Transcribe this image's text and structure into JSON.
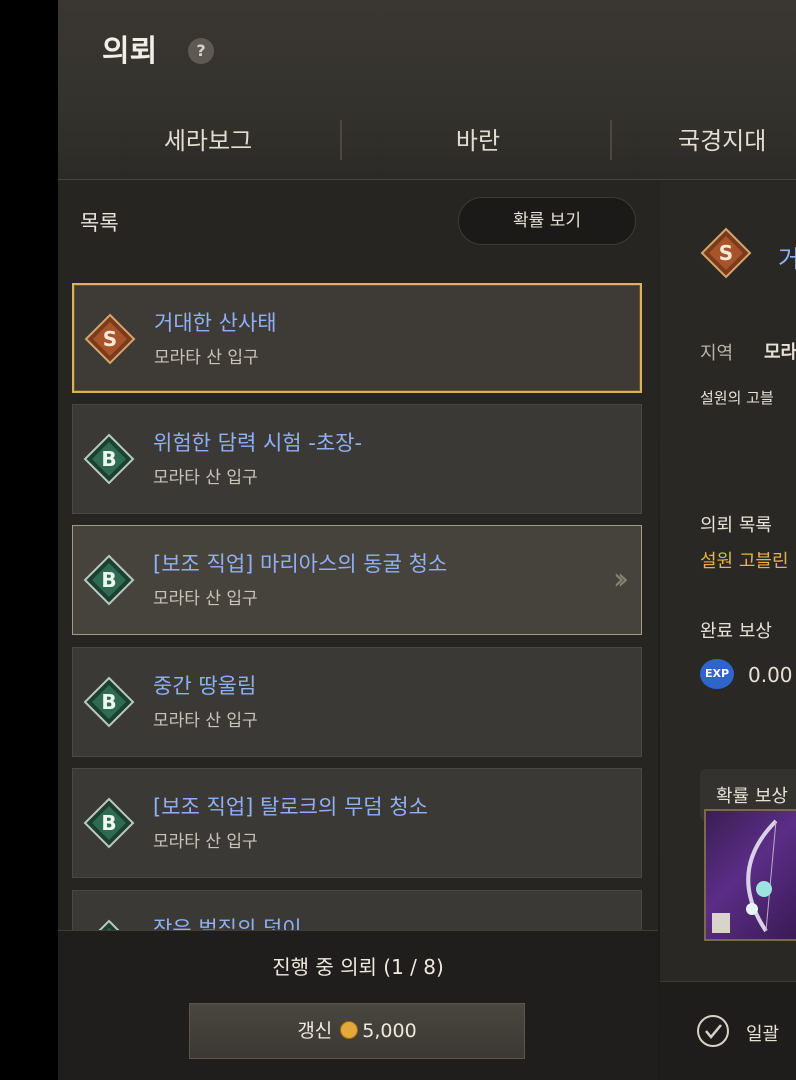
{
  "header": {
    "title": "의뢰",
    "help_icon": "?",
    "tabs": [
      "세라보그",
      "바란",
      "국경지대"
    ]
  },
  "left": {
    "label": "목록",
    "prob_button": "확률 보기",
    "quests": [
      {
        "grade": "S",
        "title": "거대한 산사태",
        "location": "모라타 산 입구"
      },
      {
        "grade": "B",
        "title": "위험한 담력 시험 -초장-",
        "location": "모라타 산 입구"
      },
      {
        "grade": "B",
        "title": "[보조 직업] 마리아스의 동굴 청소",
        "location": "모라타 산 입구"
      },
      {
        "grade": "B",
        "title": "중간 땅울림",
        "location": "모라타 산 입구"
      },
      {
        "grade": "B",
        "title": "[보조 직업] 탈로크의 무덤 청소",
        "location": "모라타 산 입구"
      },
      {
        "grade": "B",
        "title": "작은 벌집의 덫이",
        "location": ""
      }
    ],
    "progress_text": "진행 중 의뢰 (1 / 8)",
    "refresh_label": "갱신",
    "refresh_cost": "5,000"
  },
  "right": {
    "title": "거",
    "region_label": "지역",
    "region_value": "모라",
    "desc": "설원의 고블",
    "list_label": "의뢰 목록",
    "list_value": "설원 고블린",
    "reward_label": "완료 보상",
    "exp_icon": "EXP",
    "exp_value": "0.00",
    "prob_reward_label": "확률 보상",
    "bulk_label": "일괄"
  },
  "colors": {
    "accent_gold": "#d9b25a",
    "title_blue": "#8fb0f2",
    "grade_s": "#a8542a",
    "grade_b": "#2f6b52"
  }
}
